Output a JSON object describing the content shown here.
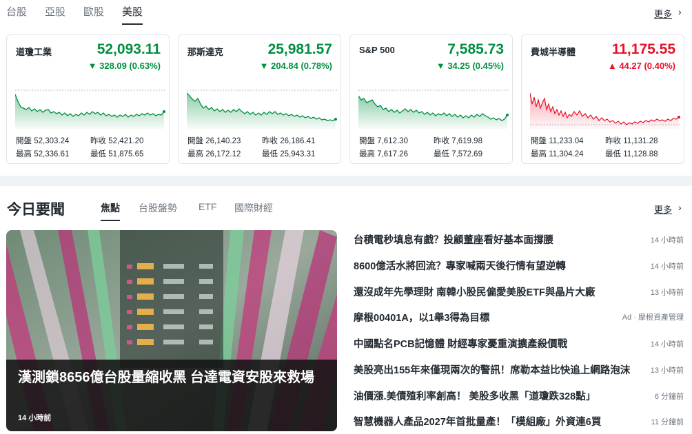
{
  "market_tabs": [
    "台股",
    "亞股",
    "歐股",
    "美股"
  ],
  "active_market_tab": "美股",
  "more_label": "更多",
  "indices": [
    {
      "name": "道瓊工業",
      "price": "52,093.11",
      "change": "▼ 328.09 (0.63%)",
      "direction": "down",
      "open_label": "開盤",
      "open": "52,303.24",
      "prev_label": "昨收",
      "prev": "52,421.20",
      "high_label": "最高",
      "high": "52,336.61",
      "low_label": "最低",
      "low": "51,875.65"
    },
    {
      "name": "那斯達克",
      "price": "25,981.57",
      "change": "▼ 204.84 (0.78%)",
      "direction": "down",
      "open_label": "開盤",
      "open": "26,140.23",
      "prev_label": "昨收",
      "prev": "26,186.41",
      "high_label": "最高",
      "high": "26,172.12",
      "low_label": "最低",
      "low": "25,943.31"
    },
    {
      "name": "S&P 500",
      "price": "7,585.73",
      "change": "▼ 34.25 (0.45%)",
      "direction": "down",
      "open_label": "開盤",
      "open": "7,612.30",
      "prev_label": "昨收",
      "prev": "7,619.98",
      "high_label": "最高",
      "high": "7,617.26",
      "low_label": "最低",
      "low": "7,572.69"
    },
    {
      "name": "費城半導體",
      "price": "11,175.55",
      "change": "▲ 44.27 (0.40%)",
      "direction": "up",
      "open_label": "開盤",
      "open": "11,233.04",
      "prev_label": "昨收",
      "prev": "11,131.28",
      "high_label": "最高",
      "high": "11,304.24",
      "low_label": "最低",
      "low": "11,128.88"
    }
  ],
  "colors": {
    "up": "#eb0f29",
    "down": "#008f40",
    "text": "#232a31",
    "muted": "#6e7780"
  },
  "news": {
    "title": "今日要聞",
    "tabs": [
      "焦點",
      "台股盤勢",
      "ETF",
      "國際財經"
    ],
    "active_tab": "焦點",
    "more_label": "更多",
    "hero": {
      "headline": "漢測鎖8656億台股量縮收黑 台達電資安股來救場",
      "time": "14 小時前"
    },
    "items": [
      {
        "title": "台積電秒填息有戲？投顧董座看好基本面撐腰",
        "time": "14 小時前"
      },
      {
        "title": "8600億活水將回流？專家喊兩天後行情有望逆轉",
        "time": "14 小時前"
      },
      {
        "title": "還沒成年先學理財 南韓小股民偏愛美股ETF與晶片大廠",
        "time": "13 小時前"
      },
      {
        "title": "摩根00401A，以1舉3得為目標",
        "ad_label": "Ad",
        "sponsor": "摩根資產管理"
      },
      {
        "title": "中國點名PCB記憶體 財經專家憂重演擴產殺價戰",
        "time": "14 小時前"
      },
      {
        "title": "美股亮出155年來僅現兩次的警訊！席勒本益比快追上網路泡沫",
        "time": "13 小時前"
      },
      {
        "title": "油價漲.美債殖利率創高！ 美股多收黑「道瓊跌328點」",
        "time": "6 分鐘前"
      },
      {
        "title": "智慧機器人產品2027年首批量產！「模組廠」外資連6買",
        "time": "11 分鐘前"
      }
    ]
  }
}
